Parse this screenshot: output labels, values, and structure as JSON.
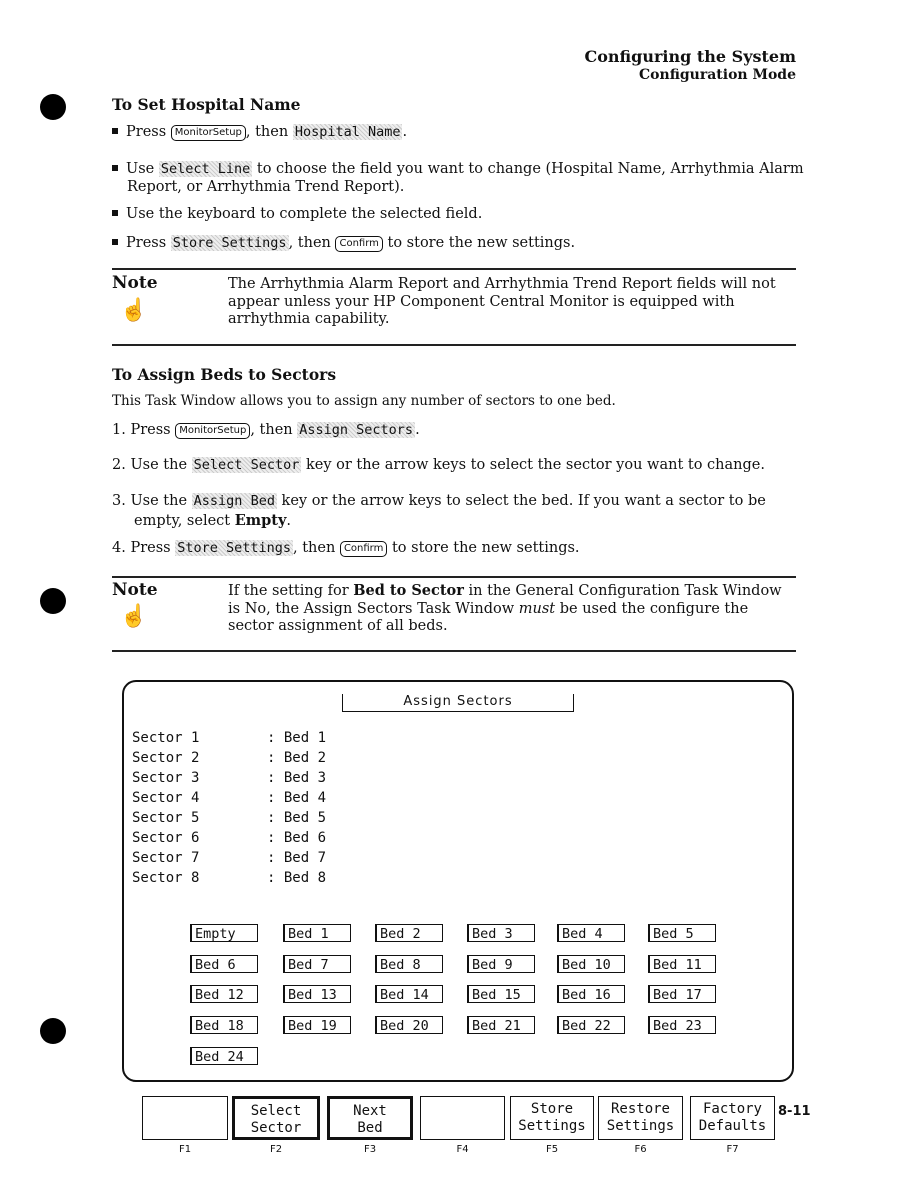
{
  "header": {
    "chapter": "Configuring the System",
    "section": "Configuration Mode"
  },
  "hospital": {
    "title": "To Set Hospital Name",
    "b1": {
      "a": "Press ",
      "key": "MonitorSetup",
      "b": ", then ",
      "soft": "Hospital Name",
      "c": "."
    },
    "b2": {
      "a": "Use ",
      "soft": "Select Line",
      "b": " to choose the field you want to change (Hospital Name, Arrhythmia Alarm Report, or Arrhythmia Trend Report)."
    },
    "b3": "Use the keyboard to complete the selected field.",
    "b4": {
      "a": "Press ",
      "soft": "Store Settings",
      "b": ", then ",
      "key": "Confirm",
      "c": " to store the new settings."
    }
  },
  "note1": {
    "label": "Note",
    "text": "The Arrhythmia Alarm Report and Arrhythmia Trend Report fields will not appear unless your HP Component Central Monitor is equipped with arrhythmia capability."
  },
  "assign": {
    "title": "To Assign Beds to Sectors",
    "intro": "This Task Window allows you to assign any number of sectors to one bed.",
    "s1": {
      "n": "1.",
      "a": "Press ",
      "key": "MonitorSetup",
      "b": ", then ",
      "soft": "Assign Sectors",
      "c": "."
    },
    "s2": {
      "n": "2.",
      "a": "Use the ",
      "soft": "Select Sector",
      "b": " key or the arrow keys to select the sector you want to change."
    },
    "s3": {
      "n": "3.",
      "a": "Use the ",
      "soft": "Assign Bed",
      "b": " key or the arrow keys to select the bed. If you want a sector to be empty, select ",
      "bold": "Empty",
      "c": "."
    },
    "s4": {
      "n": "4.",
      "a": "Press ",
      "soft": "Store Settings",
      "b": ", then ",
      "key": "Confirm",
      "c": " to store the new settings."
    }
  },
  "note2": {
    "label": "Note",
    "a": "If the setting for ",
    "bold": "Bed to Sector",
    "b": " in the General Configuration Task Window is No, the Assign Sectors Task Window ",
    "em": "must",
    "c": " be used the configure the sector assignment of all beds."
  },
  "screen": {
    "title": "Assign Sectors",
    "rows": [
      {
        "sector": "Sector 1",
        "bed": ": Bed 1"
      },
      {
        "sector": "Sector 2",
        "bed": ": Bed 2"
      },
      {
        "sector": "Sector 3",
        "bed": ": Bed 3"
      },
      {
        "sector": "Sector 4",
        "bed": ": Bed 4"
      },
      {
        "sector": "Sector 5",
        "bed": ": Bed 5"
      },
      {
        "sector": "Sector 6",
        "bed": ": Bed 6"
      },
      {
        "sector": "Sector 7",
        "bed": ": Bed 7"
      },
      {
        "sector": "Sector 8",
        "bed": ": Bed 8"
      }
    ],
    "buttons": [
      "Empty",
      "Bed 1",
      "Bed 2",
      "Bed 3",
      "Bed 4",
      "Bed 5",
      "Bed 6",
      "Bed 7",
      "Bed 8",
      "Bed 9",
      "Bed 10",
      "Bed 11",
      "Bed 12",
      "Bed 13",
      "Bed 14",
      "Bed 15",
      "Bed 16",
      "Bed 17",
      "Bed 18",
      "Bed 19",
      "Bed 20",
      "Bed 21",
      "Bed 22",
      "Bed 23",
      "Bed 24"
    ]
  },
  "softkeys": [
    {
      "l1": "",
      "l2": "",
      "f": "F1"
    },
    {
      "l1": "Select",
      "l2": "Sector",
      "f": "F2"
    },
    {
      "l1": "Next",
      "l2": "Bed",
      "f": "F3"
    },
    {
      "l1": "",
      "l2": "",
      "f": "F4"
    },
    {
      "l1": "Store",
      "l2": "Settings",
      "f": "F5"
    },
    {
      "l1": "Restore",
      "l2": "Settings",
      "f": "F6"
    },
    {
      "l1": "Factory",
      "l2": "Defaults",
      "f": "F7"
    }
  ],
  "page_number": "8-11"
}
